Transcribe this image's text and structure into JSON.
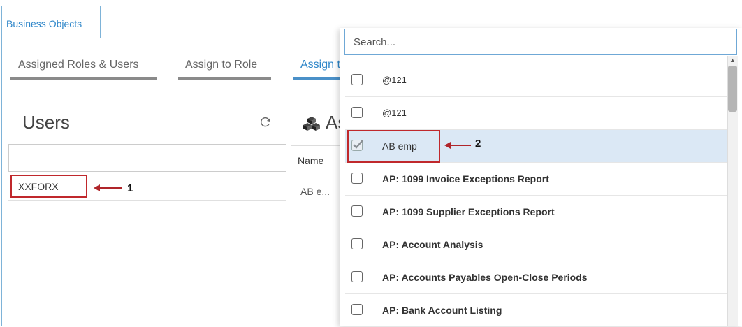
{
  "top_tab": {
    "label": "Business Objects"
  },
  "sub_tabs": [
    {
      "label": "Assigned Roles & Users"
    },
    {
      "label": "Assign to Role"
    },
    {
      "label": "Assign to"
    }
  ],
  "users_panel": {
    "title": "Users",
    "search_value": "",
    "rows": [
      {
        "name": "XXFORX"
      }
    ]
  },
  "assigned_panel": {
    "title": "As",
    "column_name": "Name",
    "rows": [
      {
        "name": "AB e..."
      }
    ]
  },
  "dropdown": {
    "search_placeholder": "Search...",
    "items": [
      {
        "label": "@121",
        "checked": false
      },
      {
        "label": "@121",
        "checked": false
      },
      {
        "label": "AB emp",
        "checked": true
      },
      {
        "label": "AP: 1099 Invoice Exceptions Report",
        "checked": false
      },
      {
        "label": "AP: 1099 Supplier Exceptions Report",
        "checked": false
      },
      {
        "label": "AP: Account Analysis",
        "checked": false
      },
      {
        "label": "AP: Accounts Payables Open-Close Periods",
        "checked": false
      },
      {
        "label": "AP: Bank Account Listing",
        "checked": false
      }
    ]
  },
  "annotations": [
    {
      "number": "1"
    },
    {
      "number": "2"
    }
  ],
  "colors": {
    "accent": "#2e86c9",
    "highlight_box": "#c0282c",
    "selected_row": "#dbe8f5"
  }
}
